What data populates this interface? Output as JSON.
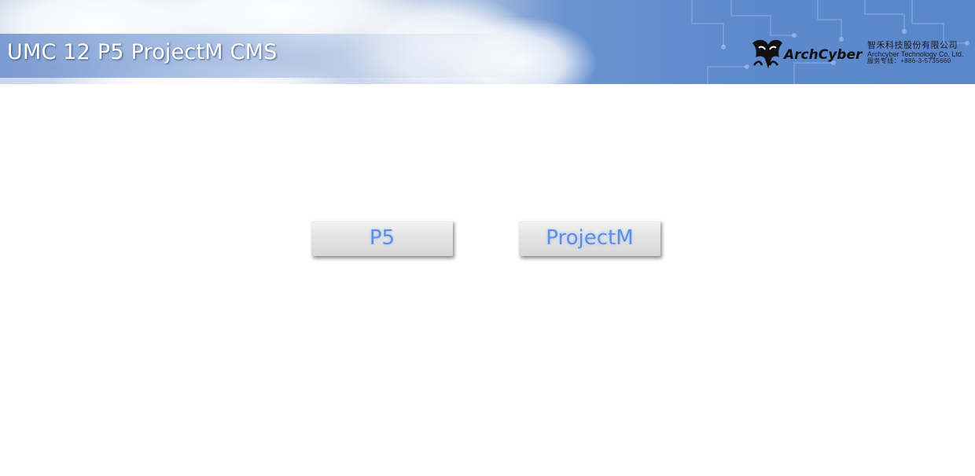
{
  "header": {
    "title": "UMC 12 P5 ProjectM CMS",
    "brand": {
      "name": "ArchCyber",
      "company_cn": "智禾科技股份有限公司",
      "company_en": "Archcyber Technology Co. Ltd.",
      "service_line": "服务专线：+886-3-5735660"
    }
  },
  "main": {
    "buttons": [
      {
        "label": "P5"
      },
      {
        "label": "ProjectM"
      }
    ]
  },
  "colors": {
    "header_blue": "#5e89cc",
    "button_text": "#5b8fe6",
    "button_face": "#e6e6e6"
  }
}
